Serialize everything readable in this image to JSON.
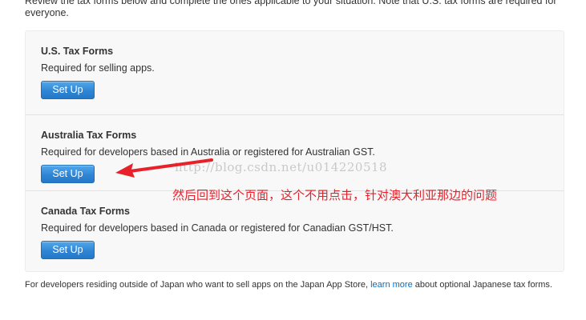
{
  "intro": {
    "text": "Review the tax forms below and complete the ones applicable to your situation. Note that U.S. tax forms are required for everyone."
  },
  "sections": [
    {
      "title": "U.S. Tax Forms",
      "description": "Required for selling apps.",
      "button_label": "Set Up"
    },
    {
      "title": "Australia Tax Forms",
      "description": "Required for developers based in Australia or registered for Australian GST.",
      "button_label": "Set Up"
    },
    {
      "title": "Canada Tax Forms",
      "description": "Required for developers based in Canada or registered for Canadian GST/HST.",
      "button_label": "Set Up"
    }
  ],
  "annotation": {
    "watermark": "http://blog.csdn.net/u014220518",
    "note": "然后回到这个页面，这个不用点击，针对澳大利亚那边的问题",
    "arrow_color": "#e8202a"
  },
  "footer": {
    "text_before": "For developers residing outside of Japan who want to sell apps on the Japan App Store, ",
    "link_label": "learn more",
    "text_after": " about optional Japanese tax forms."
  }
}
